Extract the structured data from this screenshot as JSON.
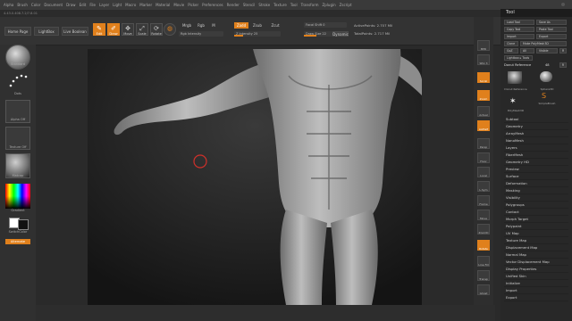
{
  "menubar": {
    "items": [
      "Alpha",
      "Brush",
      "Color",
      "Document",
      "Draw",
      "Edit",
      "File",
      "Layer",
      "Light",
      "Macro",
      "Marker",
      "Material",
      "Movie",
      "Picker",
      "Preferences",
      "Render",
      "Stencil",
      "Stroke",
      "Texture",
      "Tool",
      "Transform",
      "Zplugin",
      "Zscript"
    ]
  },
  "subbar": {
    "text": "4.43.0.408.7.2/7.8.01"
  },
  "toolbar": {
    "home_page": "Home Page",
    "lightbox": "LightBox",
    "live_boolean": "Live Boolean",
    "edit": "Edit",
    "draw": "Draw",
    "move": "Move",
    "scale": "Scale",
    "rotate": "Rotate",
    "mrgb": "Mrgb",
    "rgb": "Rgb",
    "m": "M",
    "rgb_intensity": "Rgb Intensity",
    "zadd": "Zadd",
    "zsub": "Zsub",
    "zcut": "Zcut",
    "z_intensity": "Z Intensity 25",
    "focal_shift": "Focal Shift 0",
    "draw_size": "Draw Size 22",
    "dynamic": "Dynamic",
    "active_points": "ActivePoints: 2.707 Mil",
    "total_points": "TotalPoints: 2.717 Mil"
  },
  "leftshelf": {
    "brush": "Standard",
    "stroke": "Dots",
    "alpha": "Alpha Off",
    "texture": "Texture Off",
    "material": "Matcap",
    "gradient": "Gradient",
    "switch_color": "SwitchColor",
    "alternate": "Alternate"
  },
  "righticons": [
    "BPR",
    "SPix 3",
    "Scroll",
    "Zoom",
    "Actual",
    "AAHalf",
    "Persp",
    "Floor",
    "Local",
    "L.Sym",
    "Frame",
    "Move",
    "ZoomD",
    "Rotate",
    "Line Fill",
    "Transp",
    "Ghost",
    "Solo",
    "Xpose"
  ],
  "tray": {
    "title": "Tool",
    "buttons": {
      "load_tool": "Load Tool",
      "save_as": "Save As",
      "copy_tool": "Copy Tool",
      "paste_tool": "Paste Tool",
      "import": "Import",
      "export": "Export",
      "clone": "Clone",
      "make_polymesh": "Make PolyMesh3D",
      "goz": "GoZ",
      "all": "All",
      "visible": "Visible",
      "r": "R",
      "lightbox_tools": "Lightbox ▸ Tools"
    },
    "current_tool": "Donut Reference",
    "current_tool_count": "48",
    "r_label": "R",
    "thumbs": [
      "Donut Reference",
      "Sphere3D",
      "SimpleBrush",
      "PolyMesh3D"
    ],
    "menus": [
      "Subtool",
      "Geometry",
      "ArrayMesh",
      "NanoMesh",
      "Layers",
      "FiberMesh",
      "Geometry HD",
      "Preview",
      "Surface",
      "Deformation",
      "Masking",
      "Visibility",
      "Polygroups",
      "Contact",
      "Morph Target",
      "Polypaint",
      "UV Map",
      "Texture Map",
      "Displacement Map",
      "Normal Map",
      "Vector Displacement Map",
      "Display Properties",
      "Unified Skin",
      "Initialize",
      "Import",
      "Export"
    ]
  },
  "colors": {
    "accent": "#e0801c",
    "background": "#2a2a2a",
    "canvas": "#1d1d1d"
  }
}
